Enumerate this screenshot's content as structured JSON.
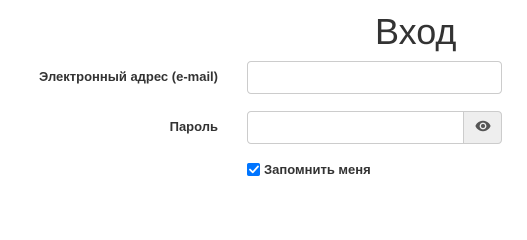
{
  "form": {
    "title": "Вход",
    "email_label": "Электронный адрес (e-mail)",
    "email_value": "",
    "password_label": "Пароль",
    "password_value": "",
    "show_password_icon": "eye-icon",
    "remember_label": "Запомнить меня",
    "remember_checked": true,
    "checkbox_color": "#0075ff"
  }
}
